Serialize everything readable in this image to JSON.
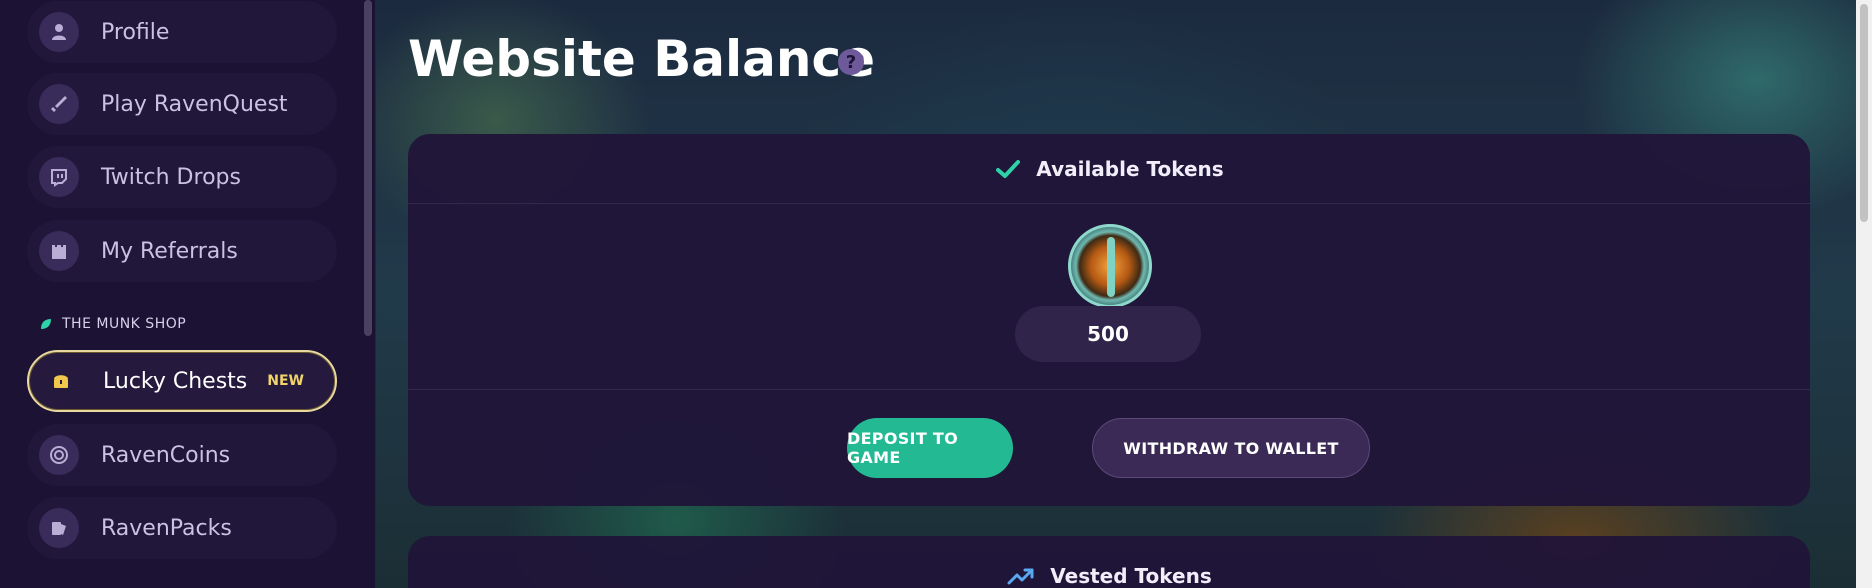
{
  "sidebar": {
    "items": [
      {
        "label": "Profile",
        "icon": "profile-icon"
      },
      {
        "label": "Play RavenQuest",
        "icon": "sword-icon"
      },
      {
        "label": "Twitch Drops",
        "icon": "twitch-icon"
      },
      {
        "label": "My Referrals",
        "icon": "castle-icon"
      }
    ],
    "section_label": "THE MUNK SHOP",
    "shop_items": [
      {
        "label": "Lucky Chests",
        "icon": "chest-icon",
        "badge": "NEW",
        "active": true
      },
      {
        "label": "RavenCoins",
        "icon": "coin-icon"
      },
      {
        "label": "RavenPacks",
        "icon": "pack-icon"
      }
    ]
  },
  "main": {
    "title": "Website Balance",
    "help_icon": "?",
    "available": {
      "header": "Available Tokens",
      "amount": "500",
      "deposit_label": "DEPOSIT TO GAME",
      "withdraw_label": "WITHDRAW TO WALLET"
    },
    "vested": {
      "header": "Vested Tokens"
    }
  },
  "colors": {
    "accent": "#23b993",
    "badge": "#f1d46a",
    "active_border": "#e9d9a0"
  }
}
